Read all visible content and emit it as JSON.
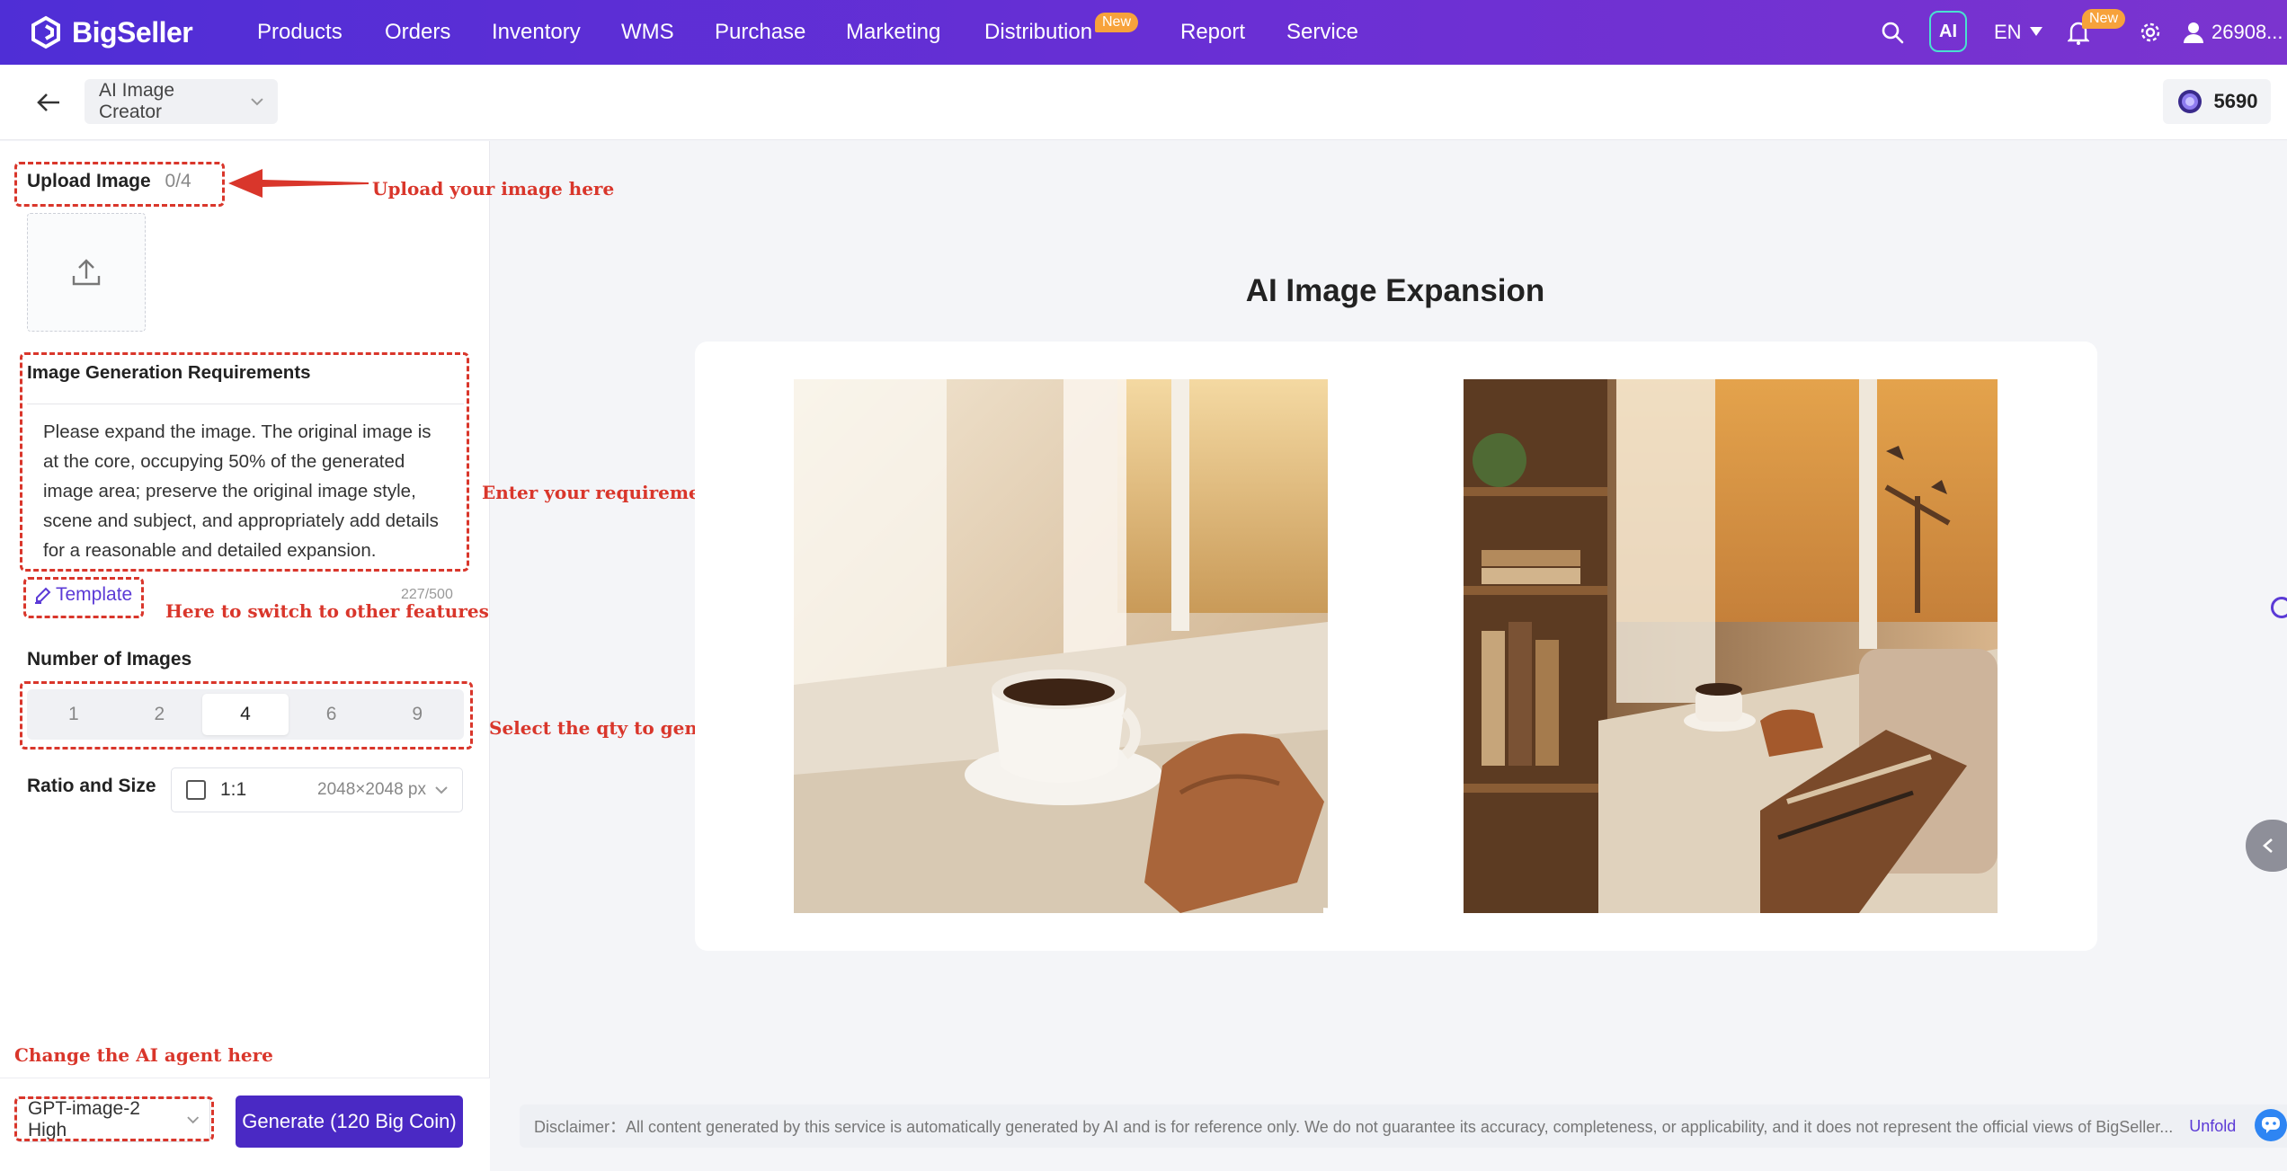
{
  "brand": {
    "name": "BigSeller",
    "accent": "#5b3ad6",
    "nav_gradient": [
      "#4f2ed6",
      "#7b34cf"
    ]
  },
  "nav": {
    "items": [
      "Products",
      "Orders",
      "Inventory",
      "WMS",
      "Purchase",
      "Marketing",
      "Distribution",
      "Report",
      "Service"
    ],
    "new_badge": "New",
    "ai_label": "AI",
    "language": "EN",
    "notification_badge": "New",
    "user": "26908..."
  },
  "subheader": {
    "tool": "AI Image Creator",
    "coins": "5690"
  },
  "left": {
    "upload_label": "Upload Image",
    "upload_count": "0/4",
    "req_label": "Image Generation Requirements",
    "req_text": "Please expand the image. The original image is at the core, occupying 50% of the generated image area; preserve the original image style, scene and subject, and appropriately add details for a reasonable and detailed expansion.",
    "template_label": "Template",
    "char_count": "227/500",
    "num_label": "Number of Images",
    "num_options": [
      "1",
      "2",
      "4",
      "6",
      "9"
    ],
    "num_selected": "4",
    "ratio_label": "Ratio and Size",
    "ratio_value": "1:1",
    "ratio_size": "2048×2048 px",
    "model": "GPT-image-2 High",
    "generate_label": "Generate (120 Big Coin)"
  },
  "annotations": {
    "upload": "Upload your image here",
    "requirements": "Enter your requirements",
    "template": "Here to switch to other features",
    "qty": "Select the qty to generate",
    "agent": "Change the AI agent here"
  },
  "main": {
    "title": "AI Image Expansion",
    "disclaimer": "Disclaimer：All content generated by this service is automatically generated by AI and is for reference only. We do not guarantee its accuracy, completeness, or applicability, and it does not represent the official views of BigSeller...",
    "unfold": "Unfold"
  },
  "icons": [
    "logo-icon",
    "search-icon",
    "caret-down-icon",
    "bell-icon",
    "gear-icon",
    "user-icon",
    "back-arrow-icon",
    "chevron-down-icon",
    "coin-icon",
    "upload-icon",
    "edit-icon",
    "chevron-left-icon",
    "help-icon"
  ]
}
